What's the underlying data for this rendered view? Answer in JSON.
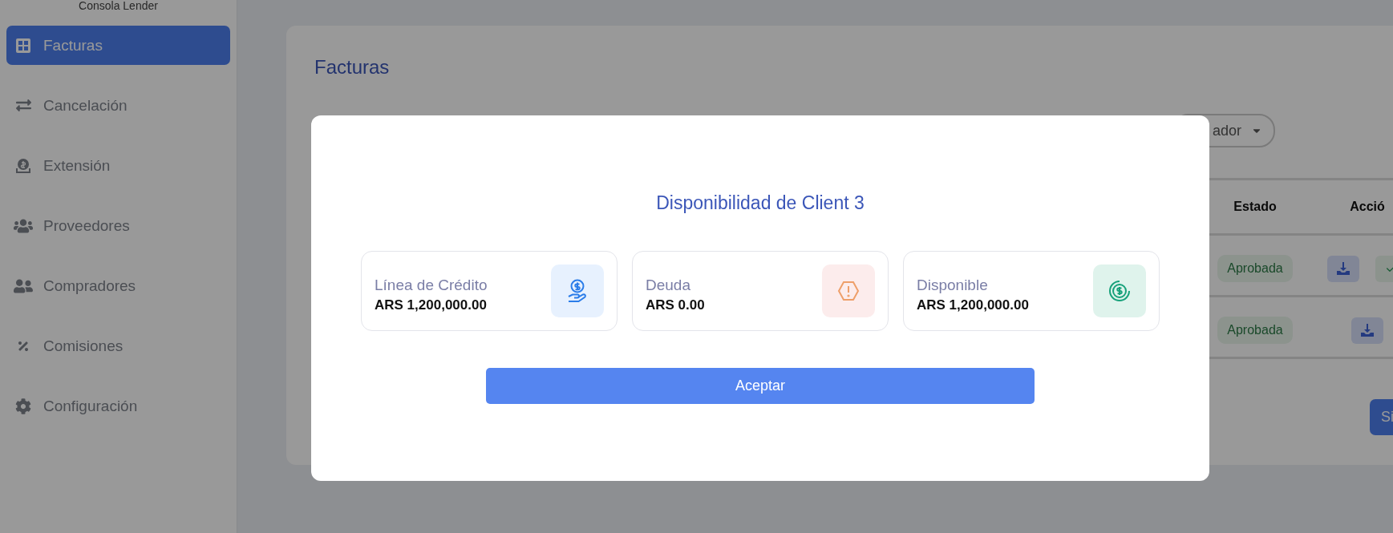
{
  "sidebar": {
    "subtitle": "Consola Lender",
    "items": [
      {
        "label": "Facturas",
        "kind": "grid",
        "selected": true
      },
      {
        "label": "Cancelación",
        "kind": "swap",
        "selected": false
      },
      {
        "label": "Extensión",
        "kind": "coin",
        "selected": false
      },
      {
        "label": "Proveedores",
        "kind": "group",
        "selected": false
      },
      {
        "label": "Compradores",
        "kind": "users",
        "selected": false
      },
      {
        "label": "Comisiones",
        "kind": "percent",
        "selected": false
      },
      {
        "label": "Configuración",
        "kind": "gear",
        "selected": false
      }
    ]
  },
  "page": {
    "title": "Facturas",
    "filter": "ador",
    "table": {
      "columns": [
        "Estado",
        "Acció"
      ],
      "rows": [
        {
          "status": "Aprobada",
          "actions": [
            {
              "kind": "download"
            },
            {
              "kind": "approve"
            }
          ]
        },
        {
          "status": "Aprobada",
          "actions": [
            {
              "kind": "download"
            }
          ]
        }
      ]
    },
    "next_button": "Si"
  },
  "modal": {
    "title": "Disponibilidad de Client 3",
    "cards": [
      {
        "kind": "credit",
        "label": "Línea de Crédito",
        "value": "ARS 1,200,000.00"
      },
      {
        "kind": "debt",
        "label": "Deuda",
        "value": "ARS 0.00"
      },
      {
        "kind": "available",
        "label": "Disponible",
        "value": "ARS 1,200,000.00"
      }
    ],
    "button": "Aceptar"
  }
}
